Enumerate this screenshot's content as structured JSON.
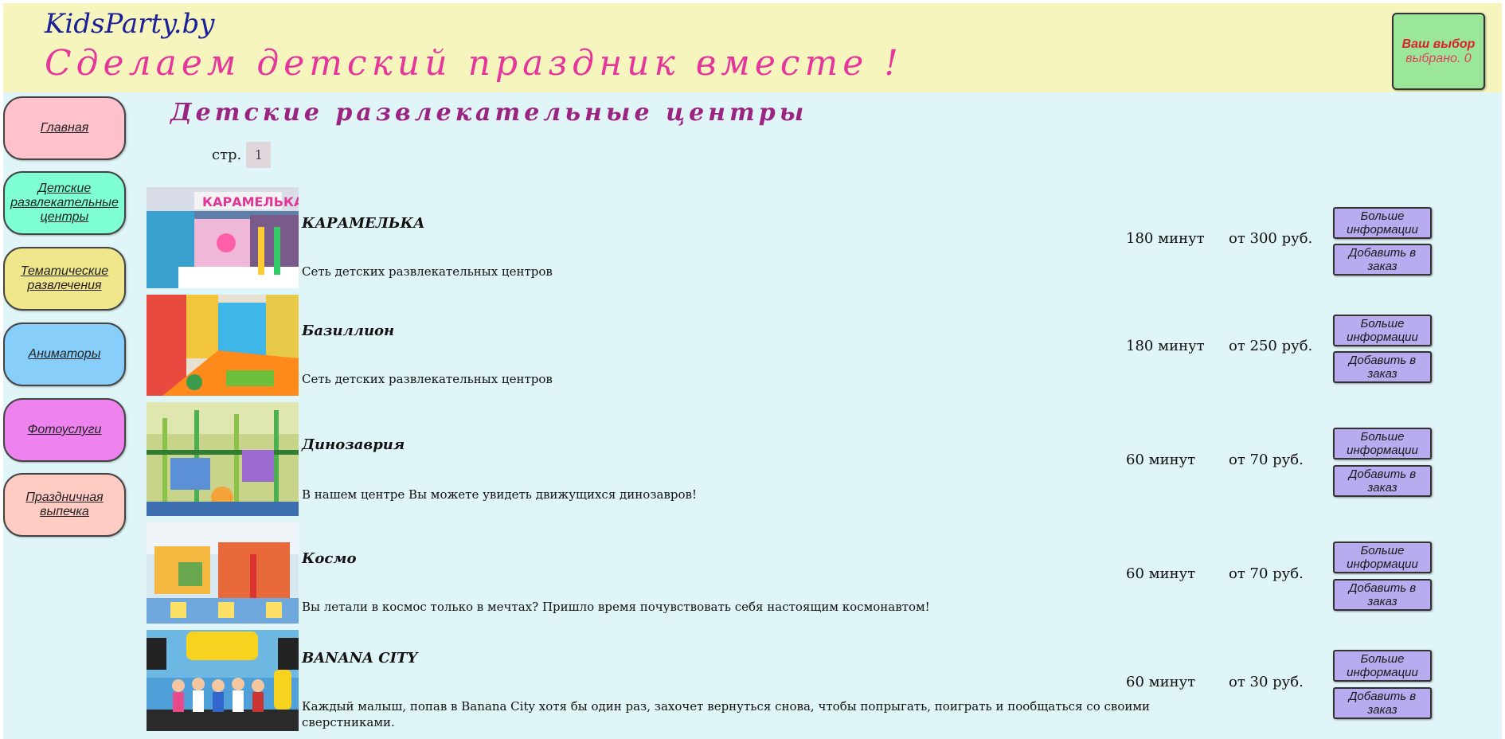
{
  "header": {
    "logo": "KidsParty.by",
    "slogan": "Сделаем детский праздник вместе !",
    "cart": {
      "title": "Ваш выбор",
      "count_line": "выбрано. 0"
    }
  },
  "colors": {
    "header_bg": "#f6f5bd",
    "main_bg": "#e0f5f7",
    "logo": "#1a1f9a",
    "slogan": "#e5379b",
    "page_title": "#9b2483",
    "cart_bg": "#9be79a",
    "cart_text": "#d9232b",
    "action_button_bg": "#b8abf0"
  },
  "sidebar": {
    "items": [
      {
        "label": "Главная",
        "color": "#ffc1cb"
      },
      {
        "label": "Детские развлекательные центры",
        "color": "#7fffd4"
      },
      {
        "label": "Тематические развлечения",
        "color": "#f0e68c"
      },
      {
        "label": "Аниматоры",
        "color": "#87cefa"
      },
      {
        "label": "Фотоуслуги",
        "color": "#ee82ee"
      },
      {
        "label": "Праздничная выпечка",
        "color": "#ffcbc3"
      }
    ]
  },
  "main": {
    "title": "Детские развлекательные центры",
    "pager": {
      "label": "стр.",
      "pages": [
        "1"
      ]
    },
    "items": [
      {
        "name": "КАРАМЕЛЬКА",
        "description": "Сеть детских развлекательных центров",
        "duration": "180 минут",
        "price": "от 300 руб.",
        "more_button": "Больше информации",
        "add_button": "Добавить в заказ"
      },
      {
        "name": "Базиллион",
        "description": "Сеть детских развлекательных центров",
        "duration": "180 минут",
        "price": "от 250 руб.",
        "more_button": "Больше информации",
        "add_button": "Добавить в заказ"
      },
      {
        "name": "Динозаврия",
        "description": "В нашем центре Вы можете увидеть движущихся динозавров!",
        "duration": "60 минут",
        "price": "от 70 руб.",
        "more_button": "Больше информации",
        "add_button": "Добавить в заказ"
      },
      {
        "name": "Космо",
        "description": "Вы летали в космос только в мечтах? Пришло время почувствовать себя настоящим космонавтом!",
        "duration": "60 минут",
        "price": "от 70 руб.",
        "more_button": "Больше информации",
        "add_button": "Добавить в заказ"
      },
      {
        "name": "BANANA CITY",
        "description": "Каждый малыш, попав в Banana City хотя бы один раз, захочет вернуться снова, чтобы попрыгать, поиграть и пообщаться со своими сверстниками.",
        "duration": "60 минут",
        "price": "от 30 руб.",
        "more_button": "Больше информации",
        "add_button": "Добавить в заказ"
      }
    ]
  }
}
